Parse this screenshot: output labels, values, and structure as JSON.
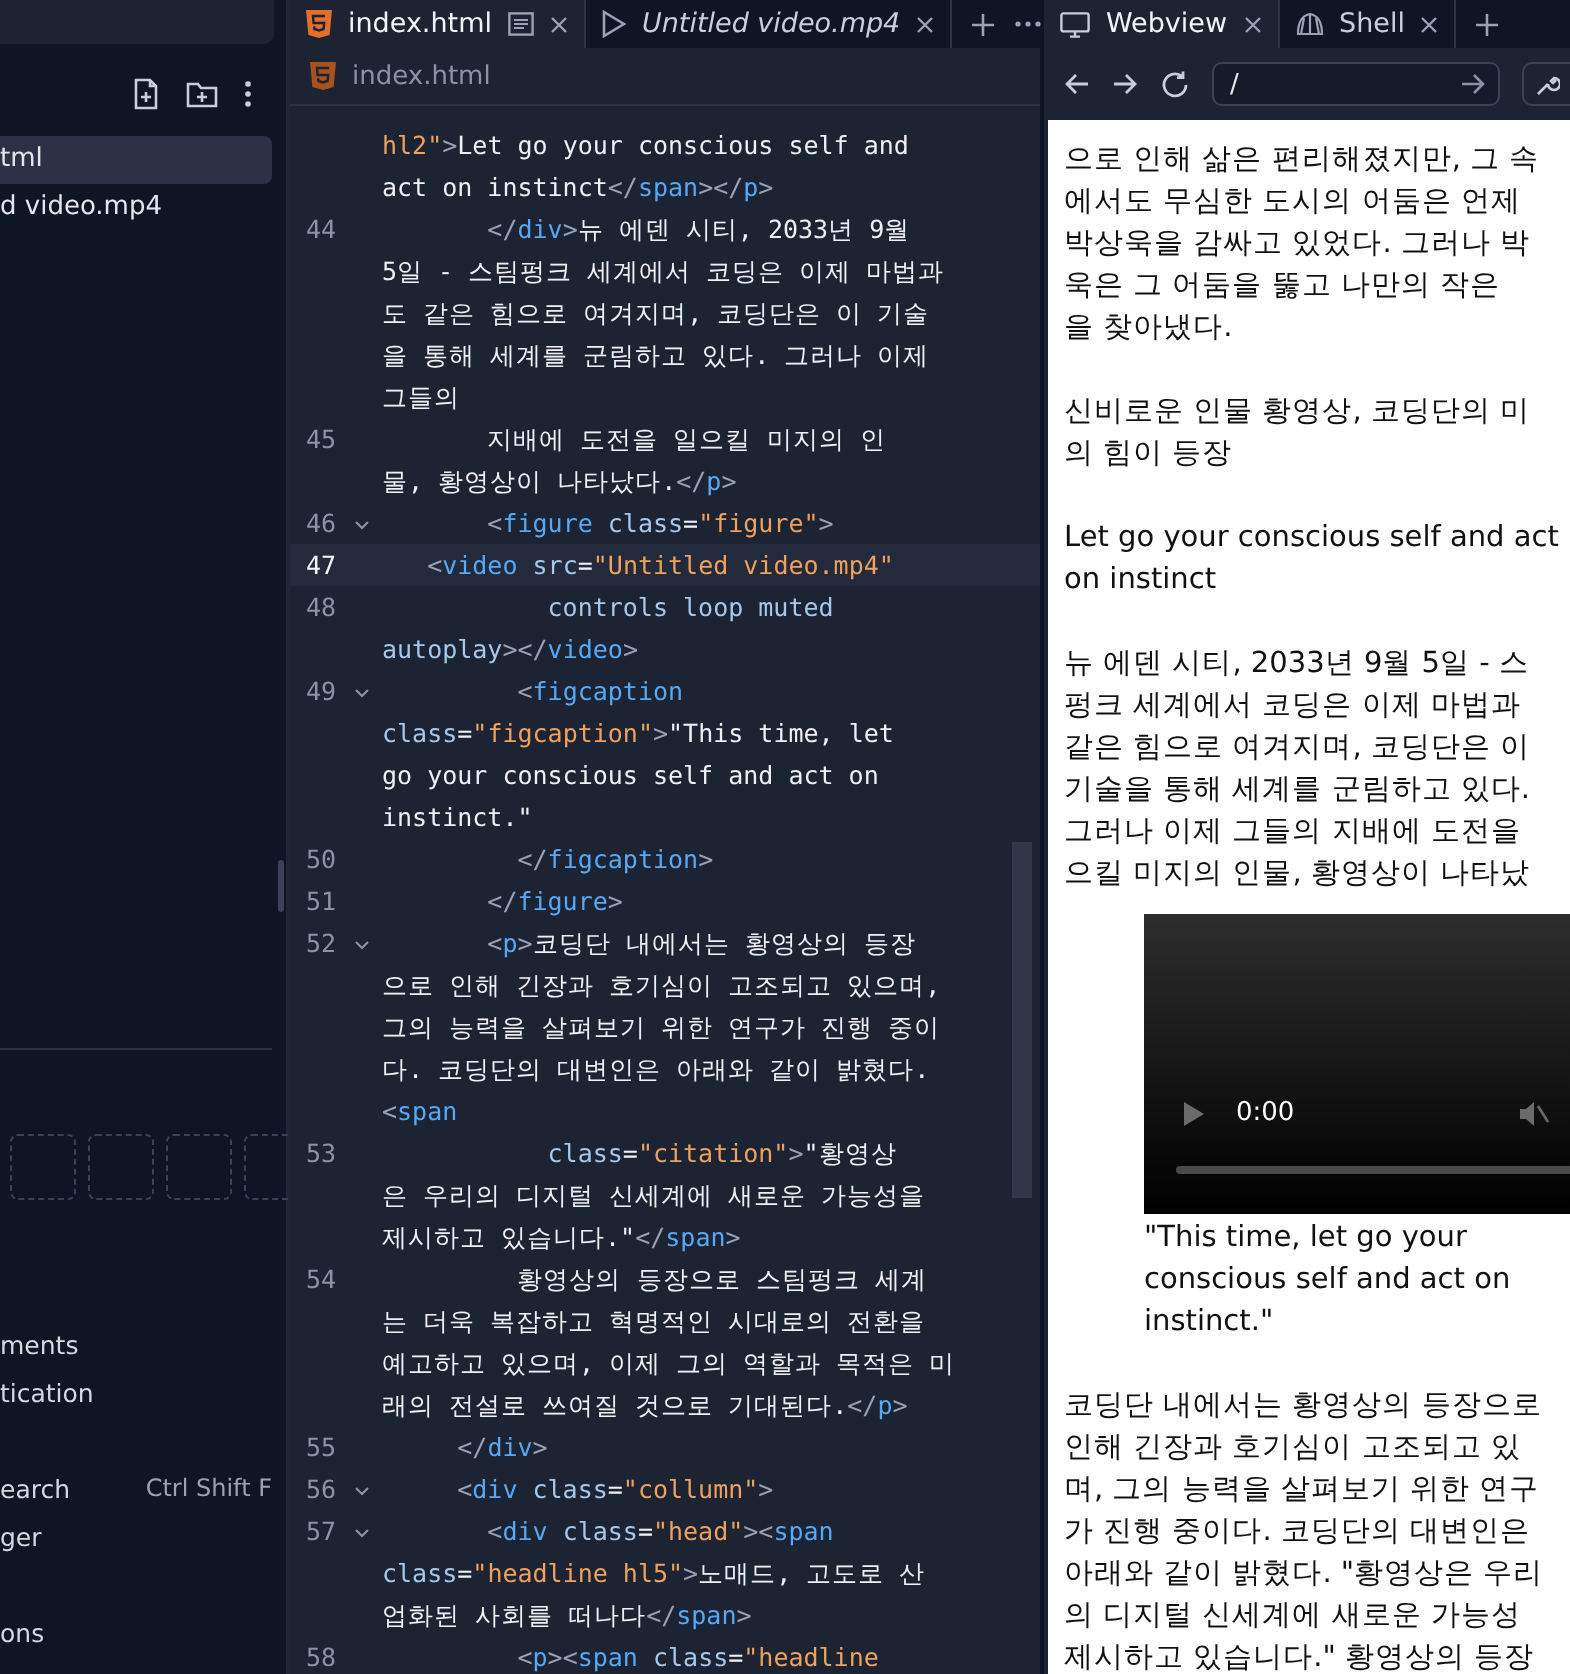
{
  "sidebar": {
    "files": [
      {
        "name": "tml",
        "selected": true
      },
      {
        "name": "d video.mp4",
        "selected": false
      }
    ],
    "tool_groups": [
      {
        "items": [
          {
            "label": "ments"
          },
          {
            "label": "tication"
          }
        ]
      },
      {
        "items": [
          {
            "label": "earch",
            "shortcut": "Ctrl Shift F"
          },
          {
            "label": "ger"
          }
        ]
      },
      {
        "items": [
          {
            "label": "ons"
          }
        ]
      }
    ]
  },
  "editor": {
    "tabs": [
      {
        "label": "index.html",
        "kind": "html",
        "selected": true
      },
      {
        "label": "Untitled video.mp4",
        "kind": "video",
        "selected": false
      }
    ],
    "breadcrumb": "index.html",
    "lines": [
      {
        "current": false,
        "foldable": false,
        "rows": [
          {
            "segments": [
              {
                "kind": "str",
                "text": "hl2\""
              },
              {
                "kind": "punct",
                "text": ">"
              },
              {
                "kind": "text",
                "text": "Let go your conscious self and"
              }
            ]
          },
          {
            "segments": [
              {
                "kind": "text",
                "text": "act on instinct"
              },
              {
                "kind": "punct",
                "text": "</"
              },
              {
                "kind": "tag",
                "text": "span"
              },
              {
                "kind": "punct",
                "text": "></"
              },
              {
                "kind": "tag",
                "text": "p"
              },
              {
                "kind": "punct",
                "text": ">"
              }
            ]
          }
        ]
      },
      {
        "number": "44",
        "current": false,
        "foldable": false,
        "rows": [
          {
            "segments": [
              {
                "kind": "punct",
                "text": "       </"
              },
              {
                "kind": "tag",
                "text": "div"
              },
              {
                "kind": "punct",
                "text": ">"
              },
              {
                "kind": "text",
                "text": "뉴 에덴 시티, 2033년 9월"
              }
            ]
          },
          {
            "segments": [
              {
                "kind": "text",
                "text": "5일 - 스팀펑크 세계에서 코딩은 이제 마법과"
              }
            ]
          },
          {
            "segments": [
              {
                "kind": "text",
                "text": "도 같은 힘으로 여겨지며, 코딩단은 이 기술"
              }
            ]
          },
          {
            "segments": [
              {
                "kind": "text",
                "text": "을 통해 세계를 군림하고 있다. 그러나 이제"
              }
            ]
          },
          {
            "segments": [
              {
                "kind": "text",
                "text": "그들의"
              }
            ]
          }
        ]
      },
      {
        "number": "45",
        "current": false,
        "foldable": false,
        "rows": [
          {
            "segments": [
              {
                "kind": "text",
                "text": "       지배에 도전을 일으킬 미지의 인"
              }
            ]
          },
          {
            "segments": [
              {
                "kind": "text",
                "text": "물, 황영상이 나타났다."
              },
              {
                "kind": "punct",
                "text": "</"
              },
              {
                "kind": "tag",
                "text": "p"
              },
              {
                "kind": "punct",
                "text": ">"
              }
            ]
          }
        ]
      },
      {
        "number": "46",
        "current": false,
        "foldable": true,
        "rows": [
          {
            "segments": [
              {
                "kind": "punct",
                "text": "       <"
              },
              {
                "kind": "tag",
                "text": "figure"
              },
              {
                "kind": "attr",
                "text": " class"
              },
              {
                "kind": "text",
                "text": "="
              },
              {
                "kind": "str",
                "text": "\"figure\""
              },
              {
                "kind": "punct",
                "text": ">"
              }
            ]
          }
        ]
      },
      {
        "number": "47",
        "current": true,
        "foldable": false,
        "rows": [
          {
            "segments": [
              {
                "kind": "punct",
                "text": "   <"
              },
              {
                "kind": "tag",
                "text": "video"
              },
              {
                "kind": "attr",
                "text": " src"
              },
              {
                "kind": "text",
                "text": "="
              },
              {
                "kind": "str",
                "text": "\"Untitled video.mp4\""
              }
            ]
          }
        ]
      },
      {
        "number": "48",
        "current": false,
        "foldable": false,
        "rows": [
          {
            "segments": [
              {
                "kind": "attr",
                "text": "           controls loop muted"
              }
            ]
          },
          {
            "segments": [
              {
                "kind": "attr",
                "text": "autoplay"
              },
              {
                "kind": "punct",
                "text": "></"
              },
              {
                "kind": "tag",
                "text": "video"
              },
              {
                "kind": "punct",
                "text": ">"
              }
            ]
          }
        ]
      },
      {
        "number": "49",
        "current": false,
        "foldable": true,
        "rows": [
          {
            "segments": [
              {
                "kind": "punct",
                "text": "         <"
              },
              {
                "kind": "tag",
                "text": "figcaption"
              }
            ]
          },
          {
            "segments": [
              {
                "kind": "attr",
                "text": "class"
              },
              {
                "kind": "text",
                "text": "="
              },
              {
                "kind": "str",
                "text": "\"figcaption\""
              },
              {
                "kind": "punct",
                "text": ">"
              },
              {
                "kind": "text",
                "text": "\"This time, let"
              }
            ]
          },
          {
            "segments": [
              {
                "kind": "text",
                "text": "go your conscious self and act on"
              }
            ]
          },
          {
            "segments": [
              {
                "kind": "text",
                "text": "instinct.\""
              }
            ]
          }
        ]
      },
      {
        "number": "50",
        "current": false,
        "foldable": false,
        "rows": [
          {
            "segments": [
              {
                "kind": "punct",
                "text": "         </"
              },
              {
                "kind": "tag",
                "text": "figcaption"
              },
              {
                "kind": "punct",
                "text": ">"
              }
            ]
          }
        ]
      },
      {
        "number": "51",
        "current": false,
        "foldable": false,
        "rows": [
          {
            "segments": [
              {
                "kind": "punct",
                "text": "       </"
              },
              {
                "kind": "tag",
                "text": "figure"
              },
              {
                "kind": "punct",
                "text": ">"
              }
            ]
          }
        ]
      },
      {
        "number": "52",
        "current": false,
        "foldable": true,
        "rows": [
          {
            "segments": [
              {
                "kind": "punct",
                "text": "       <"
              },
              {
                "kind": "tag",
                "text": "p"
              },
              {
                "kind": "punct",
                "text": ">"
              },
              {
                "kind": "text",
                "text": "코딩단 내에서는 황영상의 등장"
              }
            ]
          },
          {
            "segments": [
              {
                "kind": "text",
                "text": "으로 인해 긴장과 호기심이 고조되고 있으며,"
              }
            ]
          },
          {
            "segments": [
              {
                "kind": "text",
                "text": "그의 능력을 살펴보기 위한 연구가 진행 중이"
              }
            ]
          },
          {
            "segments": [
              {
                "kind": "text",
                "text": "다. 코딩단의 대변인은 아래와 같이 밝혔다."
              }
            ]
          },
          {
            "segments": [
              {
                "kind": "punct",
                "text": "<"
              },
              {
                "kind": "tag",
                "text": "span"
              }
            ]
          }
        ]
      },
      {
        "number": "53",
        "current": false,
        "foldable": false,
        "rows": [
          {
            "segments": [
              {
                "kind": "attr",
                "text": "           class"
              },
              {
                "kind": "text",
                "text": "="
              },
              {
                "kind": "str",
                "text": "\"citation\""
              },
              {
                "kind": "punct",
                "text": ">"
              },
              {
                "kind": "text",
                "text": "\"황영상"
              }
            ]
          },
          {
            "segments": [
              {
                "kind": "text",
                "text": "은 우리의 디지털 신세계에 새로운 가능성을"
              }
            ]
          },
          {
            "segments": [
              {
                "kind": "text",
                "text": "제시하고 있습니다.\""
              },
              {
                "kind": "punct",
                "text": "</"
              },
              {
                "kind": "tag",
                "text": "span"
              },
              {
                "kind": "punct",
                "text": ">"
              }
            ]
          }
        ]
      },
      {
        "number": "54",
        "current": false,
        "foldable": false,
        "rows": [
          {
            "segments": [
              {
                "kind": "text",
                "text": "         황영상의 등장으로 스팀펑크 세계"
              }
            ]
          },
          {
            "segments": [
              {
                "kind": "text",
                "text": "는 더욱 복잡하고 혁명적인 시대로의 전환을"
              }
            ]
          },
          {
            "segments": [
              {
                "kind": "text",
                "text": "예고하고 있으며, 이제 그의 역할과 목적은 미"
              }
            ]
          },
          {
            "segments": [
              {
                "kind": "text",
                "text": "래의 전설로 쓰여질 것으로 기대된다."
              },
              {
                "kind": "punct",
                "text": "</"
              },
              {
                "kind": "tag",
                "text": "p"
              },
              {
                "kind": "punct",
                "text": ">"
              }
            ]
          }
        ]
      },
      {
        "number": "55",
        "current": false,
        "foldable": false,
        "rows": [
          {
            "segments": [
              {
                "kind": "punct",
                "text": "     </"
              },
              {
                "kind": "tag",
                "text": "div"
              },
              {
                "kind": "punct",
                "text": ">"
              }
            ]
          }
        ]
      },
      {
        "number": "56",
        "current": false,
        "foldable": true,
        "rows": [
          {
            "segments": [
              {
                "kind": "punct",
                "text": "     <"
              },
              {
                "kind": "tag",
                "text": "div"
              },
              {
                "kind": "attr",
                "text": " class"
              },
              {
                "kind": "text",
                "text": "="
              },
              {
                "kind": "str",
                "text": "\"collumn\""
              },
              {
                "kind": "punct",
                "text": ">"
              }
            ]
          }
        ]
      },
      {
        "number": "57",
        "current": false,
        "foldable": true,
        "rows": [
          {
            "segments": [
              {
                "kind": "punct",
                "text": "       <"
              },
              {
                "kind": "tag",
                "text": "div"
              },
              {
                "kind": "attr",
                "text": " class"
              },
              {
                "kind": "text",
                "text": "="
              },
              {
                "kind": "str",
                "text": "\"head\""
              },
              {
                "kind": "punct",
                "text": "><"
              },
              {
                "kind": "tag",
                "text": "span"
              }
            ]
          },
          {
            "segments": [
              {
                "kind": "attr",
                "text": "class"
              },
              {
                "kind": "text",
                "text": "="
              },
              {
                "kind": "str",
                "text": "\"headline hl5\""
              },
              {
                "kind": "punct",
                "text": ">"
              },
              {
                "kind": "text",
                "text": "노매드, 고도로 산"
              }
            ]
          },
          {
            "segments": [
              {
                "kind": "text",
                "text": "업화된 사회를 떠나다"
              },
              {
                "kind": "punct",
                "text": "</"
              },
              {
                "kind": "tag",
                "text": "span"
              },
              {
                "kind": "punct",
                "text": ">"
              }
            ]
          }
        ]
      },
      {
        "number": "58",
        "current": false,
        "foldable": false,
        "rows": [
          {
            "segments": [
              {
                "kind": "punct",
                "text": "         <"
              },
              {
                "kind": "tag",
                "text": "p"
              },
              {
                "kind": "punct",
                "text": "><"
              },
              {
                "kind": "tag",
                "text": "span"
              },
              {
                "kind": "attr",
                "text": " class"
              },
              {
                "kind": "text",
                "text": "="
              },
              {
                "kind": "str",
                "text": "\"headline"
              }
            ]
          }
        ]
      }
    ]
  },
  "preview": {
    "tabs": [
      {
        "label": "Webview",
        "kind": "monitor",
        "selected": true
      },
      {
        "label": "Shell",
        "kind": "shell",
        "selected": false
      }
    ],
    "url": "/",
    "blocks": [
      {
        "kind": "text",
        "lines": [
          "으로 인해 삶은 편리해졌지만, 그 속",
          "에서도 무심한 도시의 어둠은 언제",
          "박상욱을 감싸고 있었다. 그러나 박",
          "욱은 그 어둠을 뚫고 나만의 작은",
          "을 찾아냈다."
        ]
      },
      {
        "kind": "text",
        "lines": [
          "신비로운 인물 황영상, 코딩단의 미",
          "의 힘이 등장"
        ]
      },
      {
        "kind": "text",
        "lines": [
          "Let go your conscious self and act",
          "on instinct"
        ]
      },
      {
        "kind": "text",
        "lines": [
          "뉴 에덴 시티, 2033년 9월 5일 - 스",
          "펑크 세계에서 코딩은 이제 마법과",
          "같은 힘으로 여겨지며, 코딩단은 이",
          "기술을 통해 세계를 군림하고 있다.",
          "그러나 이제 그들의 지배에 도전을",
          "으킬 미지의 인물, 황영상이 나타났"
        ]
      },
      {
        "kind": "video",
        "time": "0:00",
        "level": 0,
        "lines": [
          "\"This time, let go your",
          "conscious self and act on",
          "instinct.\""
        ]
      },
      {
        "kind": "text",
        "lines": [
          "코딩단 내에서는 황영상의 등장으로",
          "인해 긴장과 호기심이 고조되고 있",
          "며, 그의 능력을 살펴보기 위한 연구",
          "가 진행 중이다. 코딩단의 대변인은",
          "아래와 같이 밝혔다. \"황영상은 우리",
          "의 디지털 신세계에 새로운 가능성",
          "제시하고 있습니다.\" 황영상의 등장"
        ]
      }
    ]
  }
}
